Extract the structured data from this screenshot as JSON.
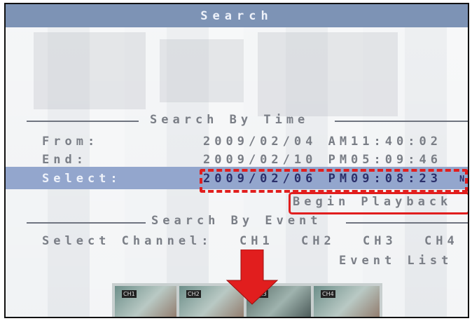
{
  "title": "Search",
  "search_by_time": {
    "heading": "Search By Time",
    "from_label": "From:",
    "from_value": "2009/02/04 AM11:40:02",
    "end_label": "End:",
    "end_value": "2009/02/10 PM05:09:46",
    "select_label": "Select:",
    "select_value": "2009/02/06 PM09:08:23",
    "cursor_char": "N",
    "begin_playback": "Begin Playback"
  },
  "search_by_event": {
    "heading": "Search By Event",
    "select_channel_label": "Select Channel:",
    "channels": [
      "CH1",
      "CH2",
      "CH3",
      "CH4"
    ],
    "event_list": "Event List"
  },
  "preview_thumbs": [
    "CH1",
    "CH2",
    "CH3",
    "CH4"
  ],
  "colors": {
    "title_bar": "#7d93b5",
    "selection_bar": "#93a6cd",
    "highlight_red": "#e11e1e",
    "text": "#7a7e86"
  },
  "icons": [
    "down-arrow-icon",
    "pointer-arrow-icon"
  ]
}
